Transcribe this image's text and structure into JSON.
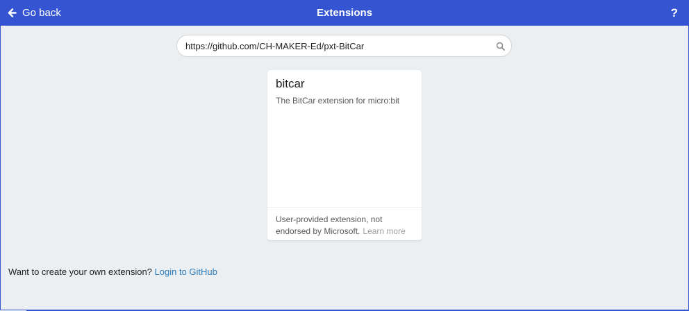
{
  "header": {
    "back_label": "Go back",
    "title": "Extensions",
    "help_label": "?",
    "back_icon": "arrow-left-icon",
    "background_color": "#3454d1"
  },
  "search": {
    "value": "https://github.com/CH-MAKER-Ed/pxt-BitCar",
    "icon": "search-icon"
  },
  "card": {
    "name": "bitcar",
    "description": "The BitCar extension for micro:bit",
    "footer_text": "User-provided extension, not endorsed by Microsoft.",
    "learn_more": "Learn more"
  },
  "footer": {
    "prompt": "Want to create your own extension?",
    "login_link": "Login to GitHub",
    "link_color": "#2c7ebf"
  }
}
